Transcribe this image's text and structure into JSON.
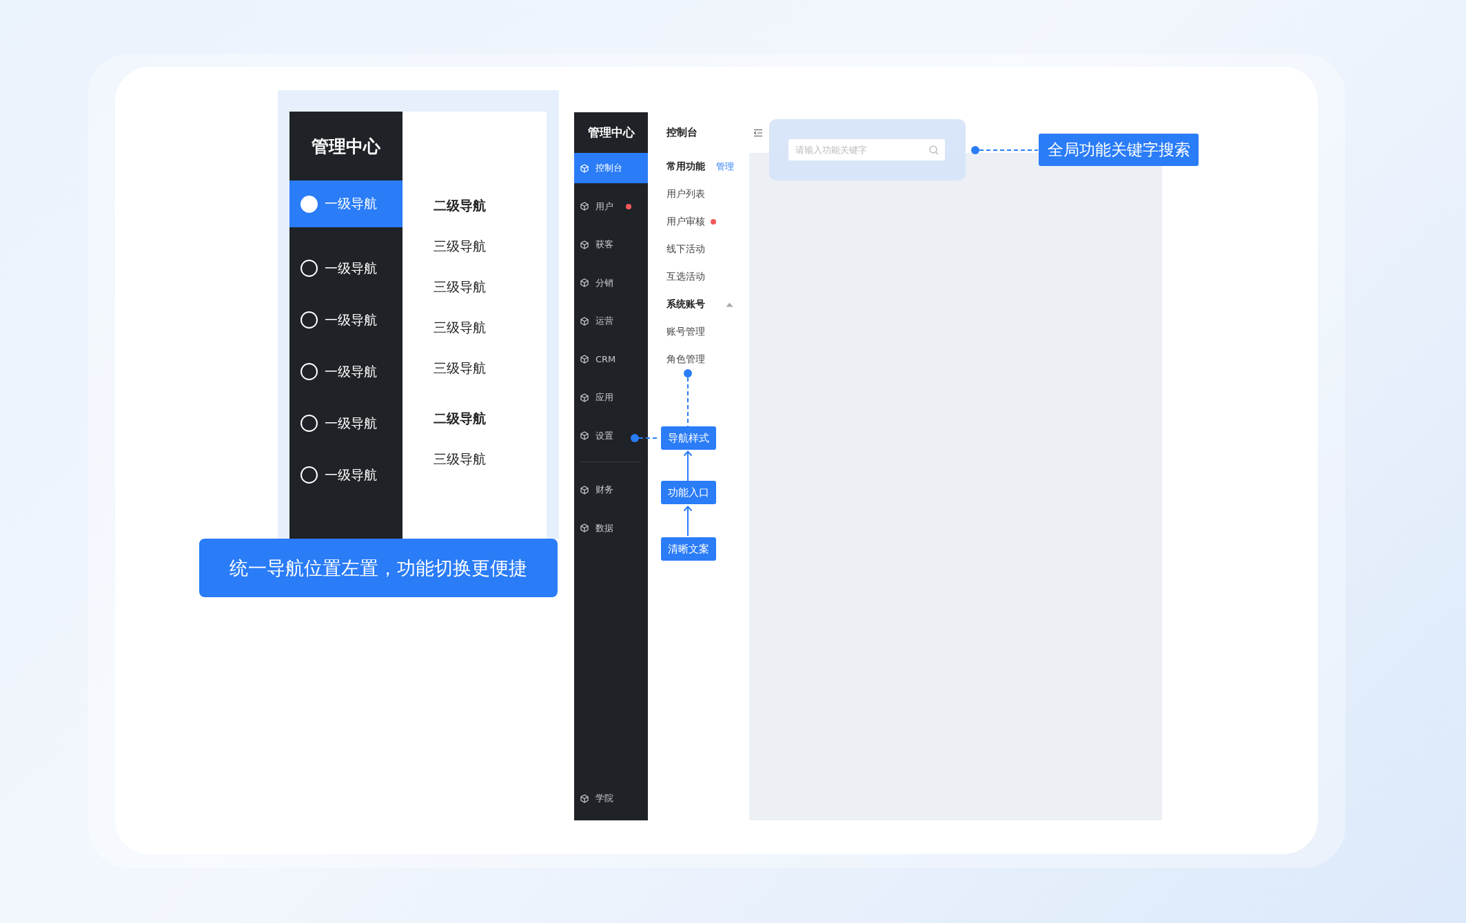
{
  "left_mockup": {
    "title": "管理中心",
    "primary_items": [
      {
        "label": "一级导航",
        "selected": true
      },
      {
        "label": "一级导航",
        "selected": false
      },
      {
        "label": "一级导航",
        "selected": false
      },
      {
        "label": "一级导航",
        "selected": false
      },
      {
        "label": "一级导航",
        "selected": false
      },
      {
        "label": "一级导航",
        "selected": false
      }
    ],
    "secondary_items": [
      {
        "kind": "secondary",
        "label": "二级导航"
      },
      {
        "kind": "tertiary",
        "label": "三级导航"
      },
      {
        "kind": "tertiary",
        "label": "三级导航"
      },
      {
        "kind": "tertiary",
        "label": "三级导航"
      },
      {
        "kind": "tertiary",
        "label": "三级导航"
      },
      {
        "kind": "secondary",
        "label": "二级导航"
      },
      {
        "kind": "tertiary",
        "label": "三级导航"
      }
    ]
  },
  "caption": "统一导航位置左置，功能切换更便捷",
  "app_mockup": {
    "sidebar": {
      "title": "管理中心",
      "groups": [
        {
          "items": [
            {
              "label": "控制台",
              "selected": true,
              "badge": false
            },
            {
              "label": "用户",
              "selected": false,
              "badge": true
            },
            {
              "label": "获客",
              "selected": false,
              "badge": false
            },
            {
              "label": "分销",
              "selected": false,
              "badge": false
            },
            {
              "label": "运营",
              "selected": false,
              "badge": false
            },
            {
              "label": "CRM",
              "selected": false,
              "badge": false
            },
            {
              "label": "应用",
              "selected": false,
              "badge": false
            },
            {
              "label": "设置",
              "selected": false,
              "badge": false
            }
          ]
        },
        {
          "items": [
            {
              "label": "财务",
              "selected": false,
              "badge": false
            },
            {
              "label": "数据",
              "selected": false,
              "badge": false
            }
          ]
        }
      ],
      "footer_item": {
        "label": "学院",
        "selected": false,
        "badge": false
      }
    },
    "header": {
      "title": "控制台"
    },
    "submenu": {
      "sections": [
        {
          "title": "常用功能",
          "action": "管理",
          "items": [
            {
              "label": "用户列表",
              "badge": false
            },
            {
              "label": "用户审核",
              "badge": true
            },
            {
              "label": "线下活动",
              "badge": false
            },
            {
              "label": "互选活动",
              "badge": false
            }
          ]
        },
        {
          "title": "系统账号",
          "expanded": true,
          "items": [
            {
              "label": "账号管理",
              "badge": false
            },
            {
              "label": "角色管理",
              "badge": false
            }
          ]
        }
      ]
    },
    "search": {
      "placeholder": "请输入功能关键字"
    }
  },
  "annotations": {
    "search_label": "全局功能关键字搜索",
    "nav_labels": [
      "导航样式",
      "功能入口",
      "清晰文案"
    ]
  }
}
